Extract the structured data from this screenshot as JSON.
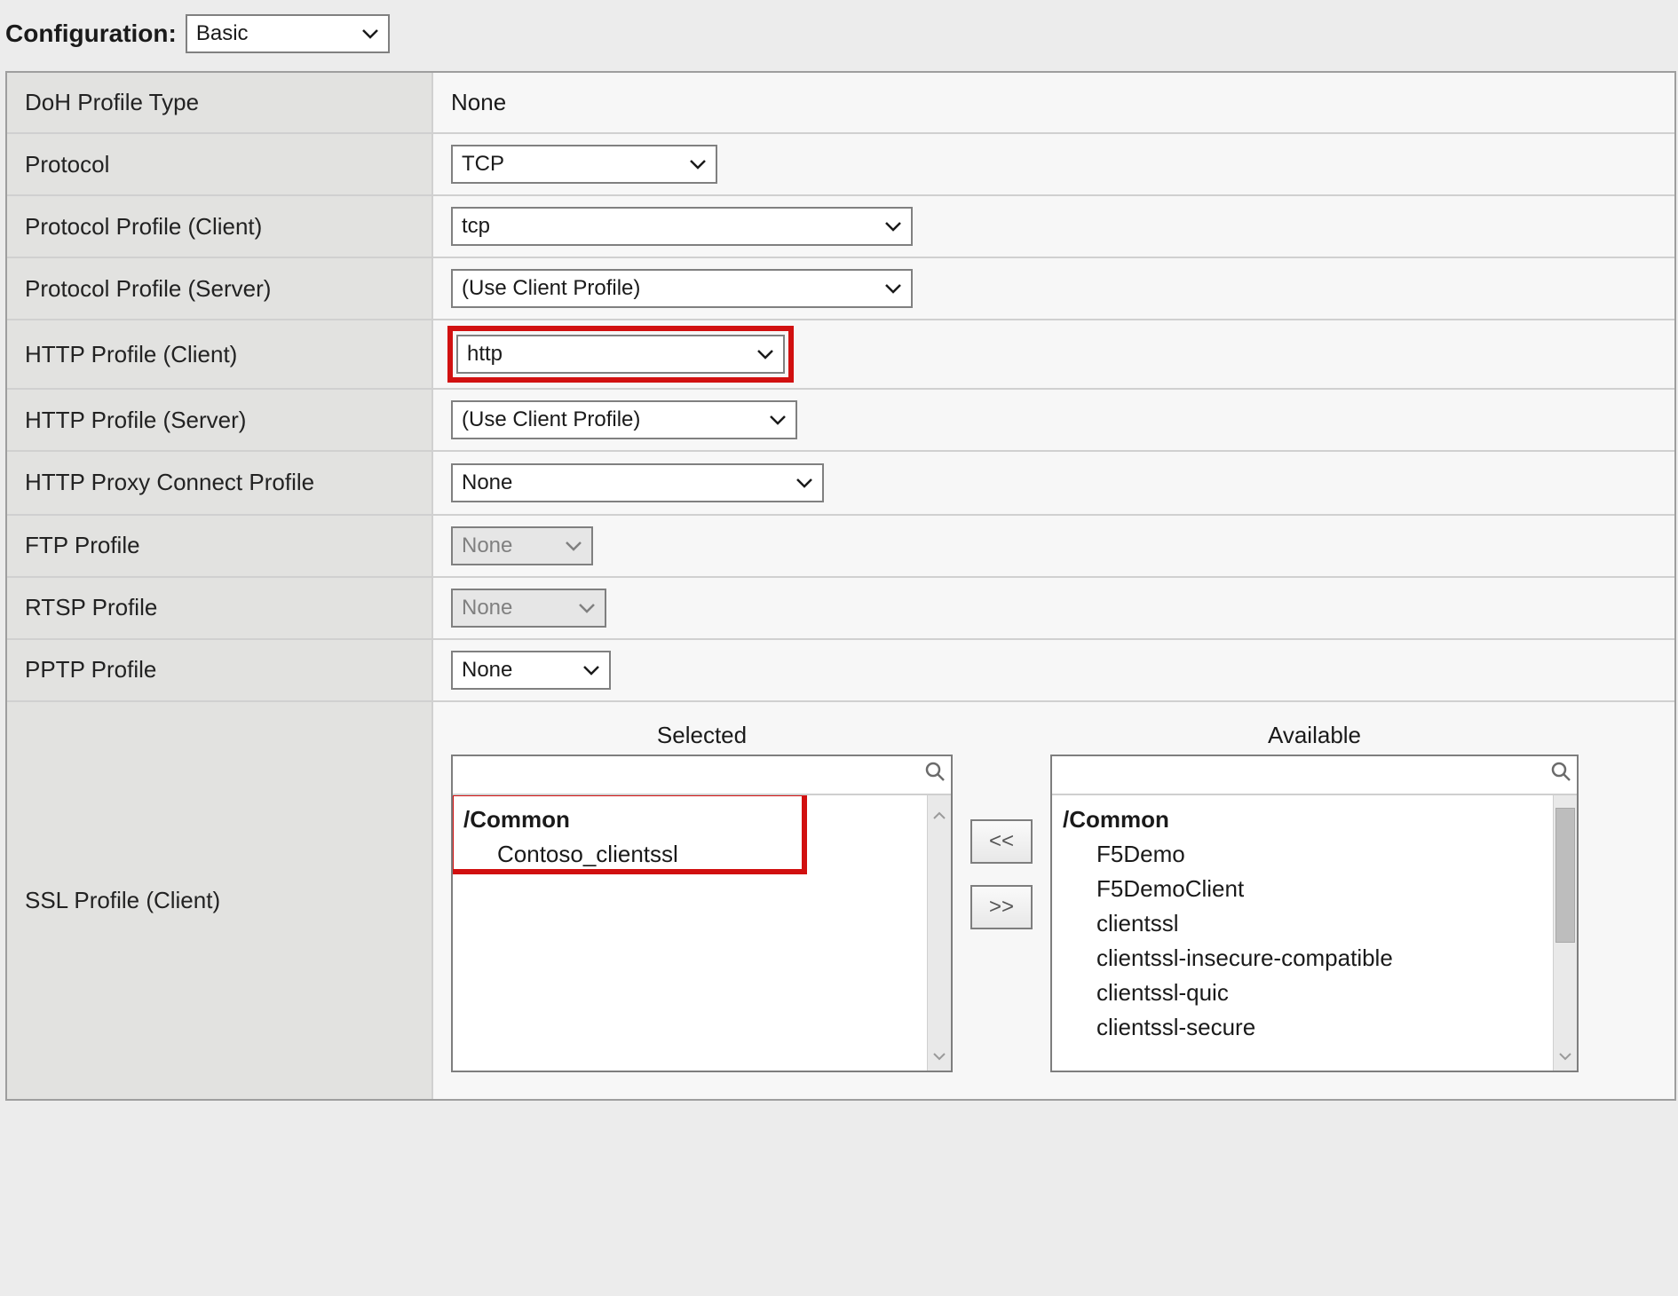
{
  "header": {
    "configuration_label": "Configuration:",
    "configuration_value": "Basic"
  },
  "rows": {
    "doh_profile_type": {
      "label": "DoH Profile Type",
      "value": "None"
    },
    "protocol": {
      "label": "Protocol",
      "value": "TCP"
    },
    "protocol_profile_client": {
      "label": "Protocol Profile (Client)",
      "value": "tcp"
    },
    "protocol_profile_server": {
      "label": "Protocol Profile (Server)",
      "value": "(Use Client Profile)"
    },
    "http_profile_client": {
      "label": "HTTP Profile (Client)",
      "value": "http"
    },
    "http_profile_server": {
      "label": "HTTP Profile (Server)",
      "value": "(Use Client Profile)"
    },
    "http_proxy_connect_profile": {
      "label": "HTTP Proxy Connect Profile",
      "value": "None"
    },
    "ftp_profile": {
      "label": "FTP Profile",
      "value": "None"
    },
    "rtsp_profile": {
      "label": "RTSP Profile",
      "value": "None"
    },
    "pptp_profile": {
      "label": "PPTP Profile",
      "value": "None"
    },
    "ssl_profile_client": {
      "label": "SSL Profile (Client)"
    }
  },
  "ssl": {
    "selected_title": "Selected",
    "available_title": "Available",
    "group_label": "/Common",
    "selected_items": [
      "Contoso_clientssl"
    ],
    "available_items": [
      "F5Demo",
      "F5DemoClient",
      "clientssl",
      "clientssl-insecure-compatible",
      "clientssl-quic",
      "clientssl-secure"
    ],
    "move_left_label": "<<",
    "move_right_label": ">>"
  }
}
